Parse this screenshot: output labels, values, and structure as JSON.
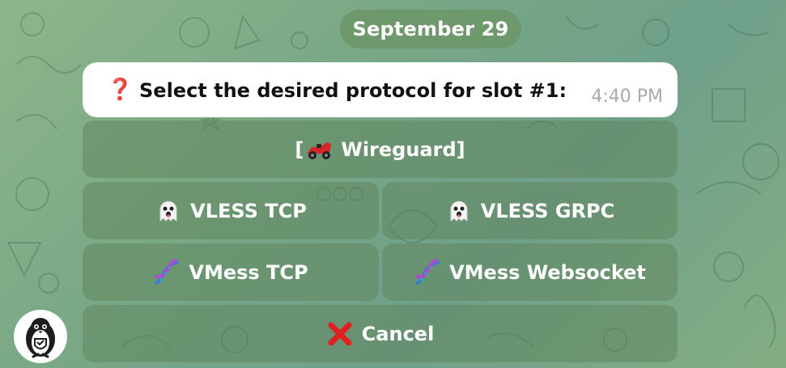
{
  "chat": {
    "date_label": "September 29",
    "message": {
      "icon": "red-question-mark-icon",
      "text": "Select the desired protocol for slot #1:",
      "time": "4:40 PM"
    },
    "keyboard": {
      "wireguard": {
        "prefix": "[",
        "label": "Wireguard]",
        "icon": "race-car-icon"
      },
      "vless_tcp": {
        "label": "VLESS TCP",
        "icon": "ghost-icon"
      },
      "vless_grpc": {
        "label": "VLESS GRPC",
        "icon": "ghost-icon"
      },
      "vmess_tcp": {
        "label": "VMess TCP",
        "icon": "dna-icon"
      },
      "vmess_ws": {
        "label": "VMess Websocket",
        "icon": "dna-icon"
      },
      "cancel": {
        "label": "Cancel",
        "icon": "red-cross-icon"
      }
    },
    "bot_avatar": {
      "icon": "penguin-shield-icon"
    }
  },
  "colors": {
    "wallpaper_green": "#7aa886",
    "button_overlay": "#60845c",
    "accent_red": "#d0262a",
    "time_gray": "#a7abaf"
  }
}
